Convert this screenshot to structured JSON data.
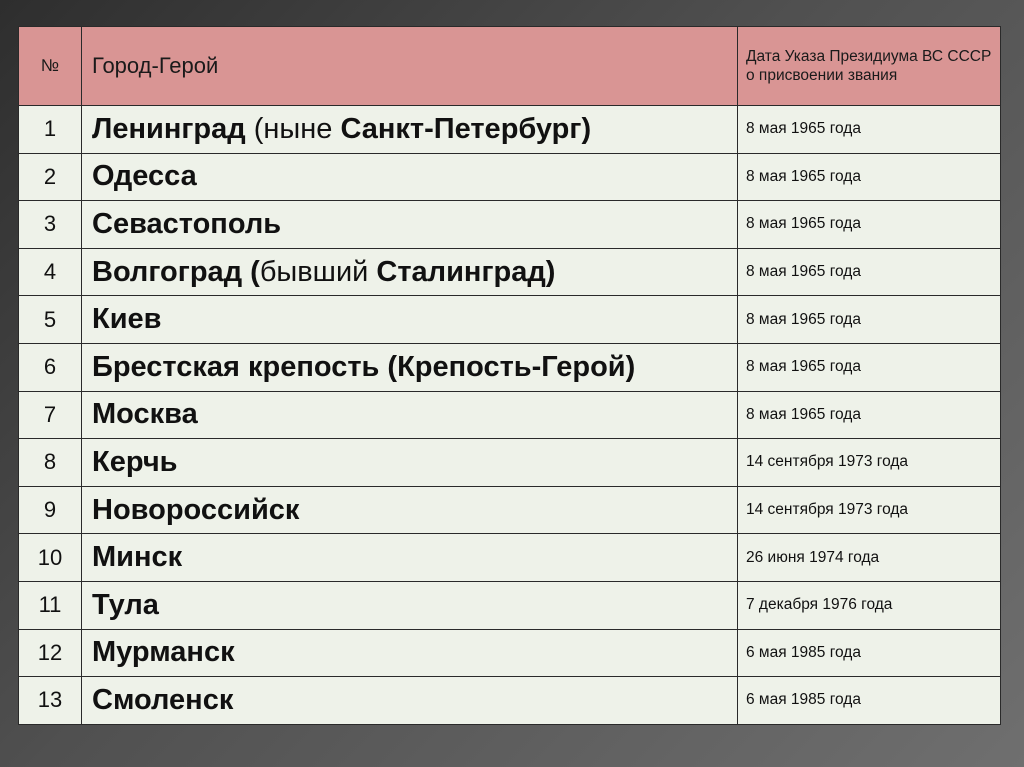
{
  "table": {
    "headers": {
      "number": "№",
      "city": "Город-Герой",
      "date": "Дата Указа Президиума ВС СССР о присвоении звания"
    },
    "rows": [
      {
        "num": "1",
        "city_before": "Ленинград",
        "city_note": " (ныне ",
        "city_after": "Санкт-Петербург)",
        "date": "8 мая 1965 года"
      },
      {
        "num": "2",
        "city_before": "Одесса",
        "city_note": "",
        "city_after": "",
        "date": "8 мая 1965 года"
      },
      {
        "num": "3",
        "city_before": "Севастополь",
        "city_note": "",
        "city_after": "",
        "date": "8 мая 1965 года"
      },
      {
        "num": "4",
        "city_before": "Волгоград (",
        "city_note": "бывший ",
        "city_after": "Сталинград)",
        "date": "8 мая 1965 года"
      },
      {
        "num": "5",
        "city_before": "Киев",
        "city_note": "",
        "city_after": "",
        "date": "8 мая 1965 года"
      },
      {
        "num": "6",
        "city_before": "Брестская крепость (Крепость-Герой)",
        "city_note": "",
        "city_after": "",
        "date": "8 мая 1965 года"
      },
      {
        "num": "7",
        "city_before": "Москва",
        "city_note": "",
        "city_after": "",
        "date": "8 мая 1965 года"
      },
      {
        "num": "8",
        "city_before": "Керчь",
        "city_note": "",
        "city_after": "",
        "date": "14 сентября 1973 года"
      },
      {
        "num": "9",
        "city_before": "Новороссийск",
        "city_note": "",
        "city_after": "",
        "date": "14 сентября 1973 года"
      },
      {
        "num": "10",
        "city_before": "Минск",
        "city_note": "",
        "city_after": "",
        "date": "26 июня 1974 года"
      },
      {
        "num": "11",
        "city_before": "Тула",
        "city_note": "",
        "city_after": "",
        "date": "7 декабря 1976 года"
      },
      {
        "num": "12",
        "city_before": "Мурманск",
        "city_note": "",
        "city_after": "",
        "date": "6 мая 1985 года"
      },
      {
        "num": "13",
        "city_before": "Смоленск",
        "city_note": "",
        "city_after": "",
        "date": "6 мая 1985 года"
      }
    ]
  },
  "colors": {
    "header_bg": "#d99594",
    "row_bg": "#eef2e9",
    "border": "#2a2a2a"
  }
}
